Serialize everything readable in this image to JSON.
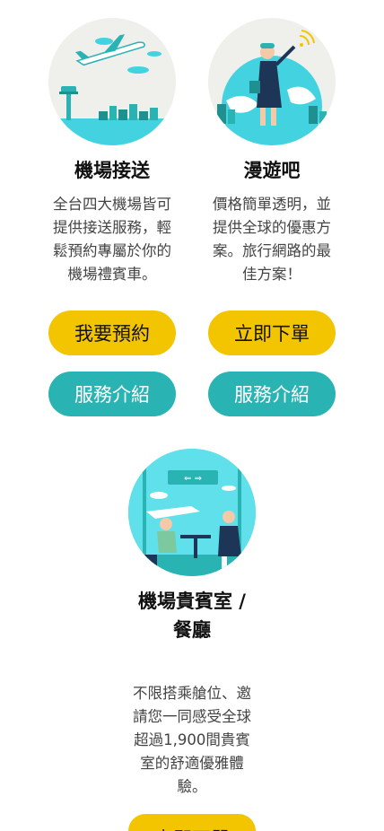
{
  "cards": [
    {
      "title": "機場接送",
      "desc_lines": [
        "全台四大機場皆可",
        "提供接送服務，輕",
        "鬆預約專屬於你的",
        "機場禮賓車。"
      ],
      "primary_button": "我要預約",
      "secondary_button": "服務介紹"
    },
    {
      "title": "漫遊吧",
      "desc_lines": [
        "價格簡單透明，並",
        "提供全球的優惠方",
        "案。旅行網路的最",
        "佳方案！"
      ],
      "primary_button": "立即下單",
      "secondary_button": "服務介紹"
    }
  ],
  "lounge": {
    "title_lines": [
      "機場貴賓室 /",
      "餐廳"
    ],
    "desc_lines": [
      "不限搭乘艙位、邀",
      "請您一同感受全球",
      "超過1,900間貴賓",
      "室的舒適優雅體",
      "驗。"
    ],
    "primary_button": "立即下單"
  },
  "colors": {
    "accent_yellow": "#f2c500",
    "accent_teal": "#2ab3b3",
    "illustration_cyan": "#43d3e0"
  }
}
